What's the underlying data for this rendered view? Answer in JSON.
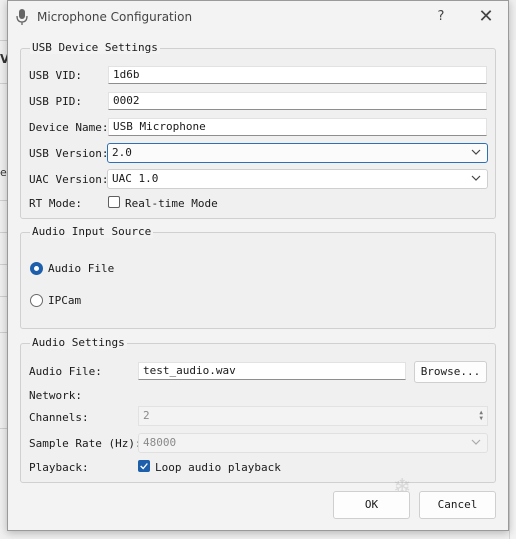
{
  "window": {
    "title": "Microphone Configuration",
    "help_glyph": "?",
    "close_glyph": "✕",
    "icon": "microphone-icon"
  },
  "background": {
    "glyph_v": "V",
    "glyph_e": "e"
  },
  "usb_group": {
    "title": "USB Device Settings",
    "vid_label": "USB VID:",
    "vid_value": "1d6b",
    "pid_label": "USB PID:",
    "pid_value": "0002",
    "name_label": "Device Name:",
    "name_value": "USB Microphone",
    "version_label": "USB Version:",
    "version_value": "2.0",
    "uac_label": "UAC Version:",
    "uac_value": "UAC 1.0",
    "rt_label": "RT Mode:",
    "rt_checkbox_label": "Real-time Mode",
    "rt_checked": false
  },
  "source_group": {
    "title": "Audio Input Source",
    "options": [
      {
        "label": "Audio File",
        "checked": true
      },
      {
        "label": "IPCam",
        "checked": false
      }
    ]
  },
  "audio_group": {
    "title": "Audio Settings",
    "file_label": "Audio File:",
    "file_value": "test_audio.wav",
    "browse_label": "Browse...",
    "network_label": "Network:",
    "channels_label": "Channels:",
    "channels_value": "2",
    "rate_label": "Sample Rate (Hz):",
    "rate_value": "48000",
    "playback_label": "Playback:",
    "loop_label": "Loop audio playback",
    "loop_checked": true
  },
  "buttons": {
    "ok_label": "OK",
    "cancel_label": "Cancel"
  },
  "colors": {
    "accent": "#1d5fab",
    "focus_border": "#2f6fb5"
  }
}
